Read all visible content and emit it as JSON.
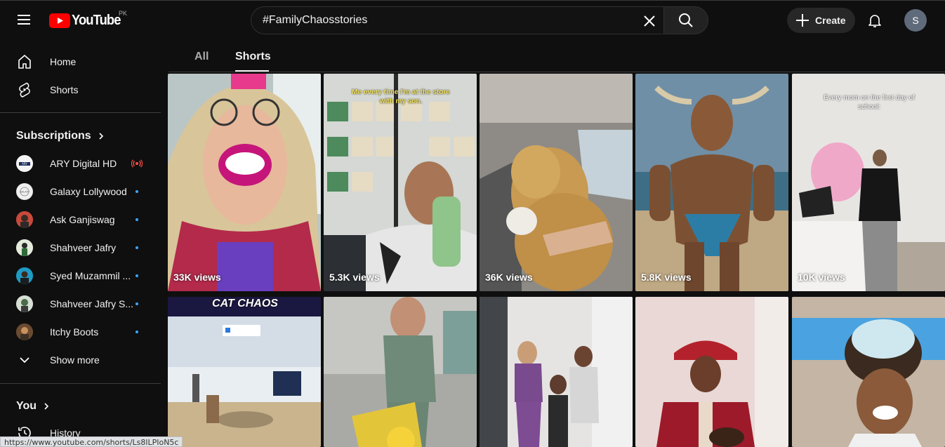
{
  "header": {
    "logo_text": "YouTube",
    "country_code": "PK",
    "search_value": "#FamilyChaosstories",
    "create_label": "Create",
    "avatar_letter": "S"
  },
  "sidebar": {
    "primary": [
      {
        "label": "Home",
        "icon": "home-icon"
      },
      {
        "label": "Shorts",
        "icon": "shorts-icon"
      }
    ],
    "subscriptions_title": "Subscriptions",
    "subscriptions": [
      {
        "name": "ARY Digital HD",
        "indicator": "live"
      },
      {
        "name": "Galaxy Lollywood",
        "indicator": "dot"
      },
      {
        "name": "Ask Ganjiswag",
        "indicator": "dot"
      },
      {
        "name": "Shahveer Jafry",
        "indicator": "dot"
      },
      {
        "name": "Syed Muzammil ...",
        "indicator": "dot"
      },
      {
        "name": "Shahveer Jafry S...",
        "indicator": "dot"
      },
      {
        "name": "Itchy Boots",
        "indicator": "dot"
      }
    ],
    "show_more_label": "Show more",
    "you_title": "You",
    "history_label": "History"
  },
  "chips": {
    "all_label": "All",
    "shorts_label": "Shorts"
  },
  "results": {
    "row1": [
      {
        "views": "33K views",
        "caption": ""
      },
      {
        "views": "5.3K views",
        "caption": "Me every time I'm at the store with my son."
      },
      {
        "views": "36K views",
        "caption": ""
      },
      {
        "views": "5.8K views",
        "caption": ""
      },
      {
        "views": "10K views",
        "caption": "Every mom on the first day of school:"
      }
    ],
    "row2": [
      {
        "views": "",
        "caption": "CAT CHAOS"
      },
      {
        "views": "",
        "caption": ""
      },
      {
        "views": "",
        "caption": ""
      },
      {
        "views": "",
        "caption": ""
      },
      {
        "views": "",
        "caption": ""
      }
    ]
  },
  "status_bar": {
    "url": "https://www.youtube.com/shorts/Ls8lLPIoN5c"
  },
  "colors": {
    "background": "#0f0f0f",
    "brand_red": "#ff0000",
    "accent_blue": "#3ea6ff"
  }
}
